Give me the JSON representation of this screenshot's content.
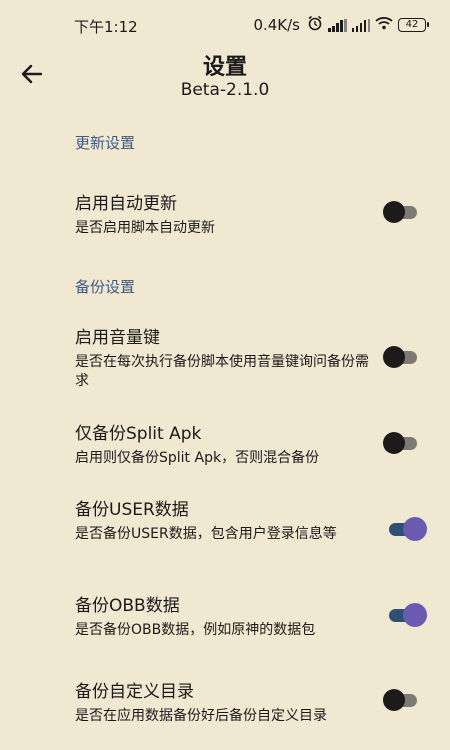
{
  "status_bar": {
    "time": "下午1:12",
    "net_speed": "0.4K/s",
    "battery": "42"
  },
  "header": {
    "title": "设置",
    "version": "Beta-2.1.0"
  },
  "sections": [
    {
      "title": "更新设置"
    },
    {
      "title": "备份设置"
    }
  ],
  "settings": [
    {
      "title": "启用自动更新",
      "desc": "是否启用脚本自动更新",
      "enabled": false
    },
    {
      "title": "启用音量键",
      "desc": "是否在每次执行备份脚本使用音量键询问备份需求",
      "enabled": false
    },
    {
      "title": "仅备份Split Apk",
      "desc": "启用则仅备份Split Apk，否则混合备份",
      "enabled": false
    },
    {
      "title": "备份USER数据",
      "desc": "是否备份USER数据，包含用户登录信息等",
      "enabled": true
    },
    {
      "title": "备份OBB数据",
      "desc": "是否备份OBB数据，例如原神的数据包",
      "enabled": true
    },
    {
      "title": "备份自定义目录",
      "desc": "是否在应用数据备份好后备份自定义目录",
      "enabled": false
    }
  ],
  "colors": {
    "background": "#f1e8d2",
    "section_header": "#3d5a85",
    "switch_on_thumb": "#6a5bb0",
    "switch_on_track": "#2f4f74",
    "switch_off_thumb": "#1c1b1a",
    "switch_off_track": "#7d7a75"
  }
}
